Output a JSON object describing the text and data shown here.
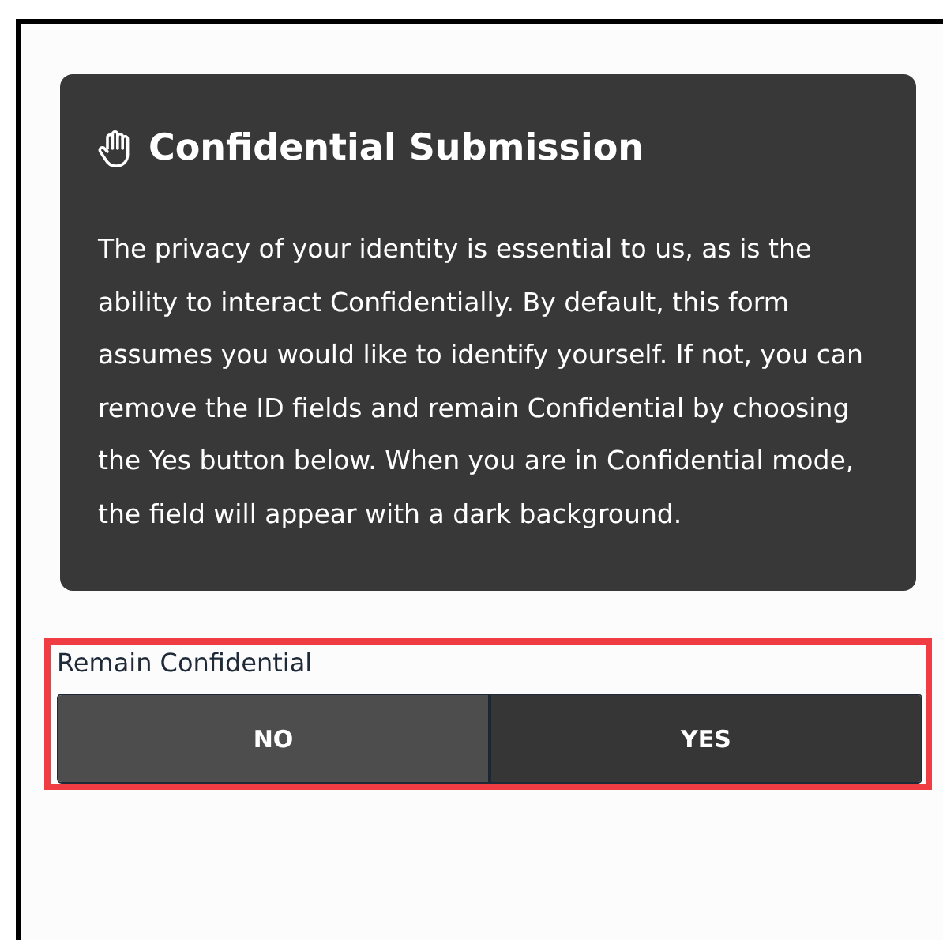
{
  "notice": {
    "title": "Confidential Submission",
    "body": "The privacy of your identity is essential to us, as is the ability to interact Confidentially. By default, this form assumes you would like to identify yourself. If not, you can remove the ID fields and remain Confidential by choosing the Yes button below. When you are in Confidential mode, the field will appear with a dark background."
  },
  "field": {
    "label": "Remain Confidential",
    "highlighted": true,
    "options": [
      {
        "label": "NO",
        "selected": true
      },
      {
        "label": "YES",
        "selected": false
      }
    ]
  }
}
